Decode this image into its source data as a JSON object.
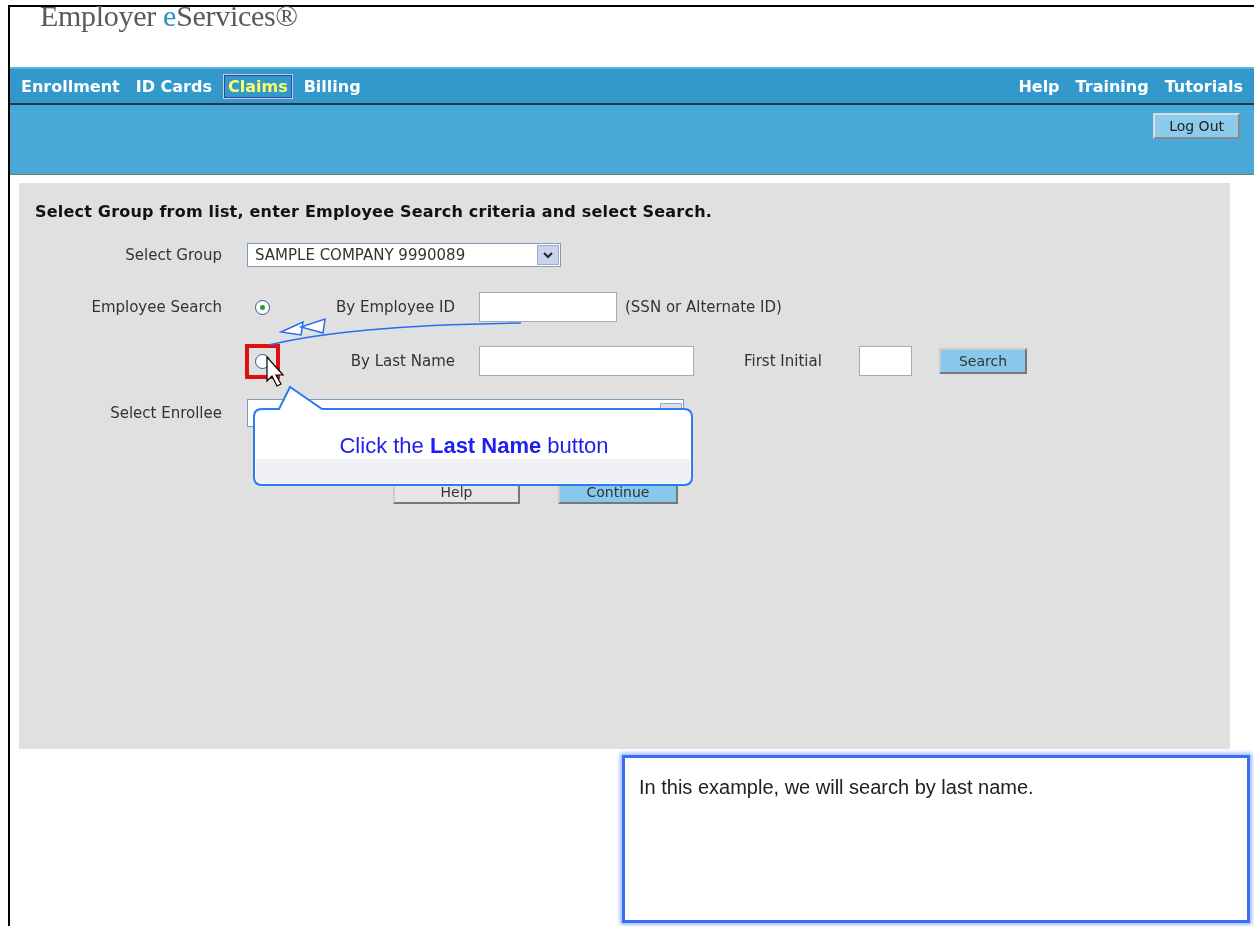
{
  "header": {
    "logo": {
      "before": "Employer ",
      "accent": "e",
      "after": "Services®"
    }
  },
  "nav": {
    "left": [
      {
        "label": "Enrollment",
        "selected": false
      },
      {
        "label": "ID Cards",
        "selected": false
      },
      {
        "label": "Claims",
        "selected": true
      },
      {
        "label": "Billing",
        "selected": false
      }
    ],
    "right": [
      "Help",
      "Training",
      "Tutorials"
    ]
  },
  "toolbar": {
    "logout_button": "Log Out"
  },
  "form": {
    "instruction": "Select Group from list, enter Employee Search criteria and select Search.",
    "group": {
      "label": "Select Group",
      "value": "SAMPLE COMPANY 9990089"
    },
    "employee_search": {
      "label": "Employee Search",
      "options": [
        {
          "label": "By Employee ID",
          "selected": true,
          "highlighted": false,
          "hint": "(SSN or Alternate ID)"
        },
        {
          "label": "By Last Name",
          "selected": false,
          "highlighted": true,
          "extra_label": "First Initial",
          "button": "Search"
        }
      ]
    },
    "enrollee": {
      "label": "Select Enrollee"
    },
    "buttons": [
      "Help",
      "Continue"
    ]
  },
  "callout": {
    "text": "Click the **Last Name** button"
  },
  "note": {
    "text": "In this example, we will search by last name."
  }
}
